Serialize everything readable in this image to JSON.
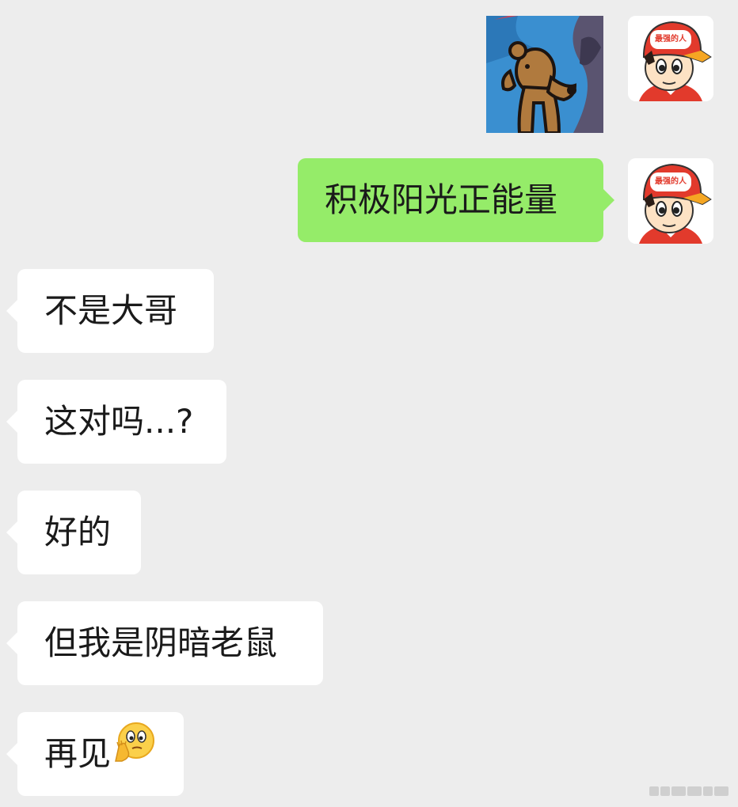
{
  "chat": {
    "me": {
      "avatar_icon": "red-cap-boy-avatar-icon",
      "cap_text": "最强的人",
      "sticker_icon": "cartoon-bear-sticker-icon",
      "bubble_text": "积极阳光正能量",
      "bubble_color": "#95ec69"
    },
    "other": {
      "bubble_color": "#ffffff",
      "messages": [
        {
          "text": "不是大哥"
        },
        {
          "text": "这对吗...?"
        },
        {
          "text": "好的"
        },
        {
          "text": "但我是阴暗老鼠"
        },
        {
          "text": "再见",
          "emoji_icon": "thinking-face-emoji-icon"
        }
      ]
    }
  },
  "background_color": "#ededed"
}
